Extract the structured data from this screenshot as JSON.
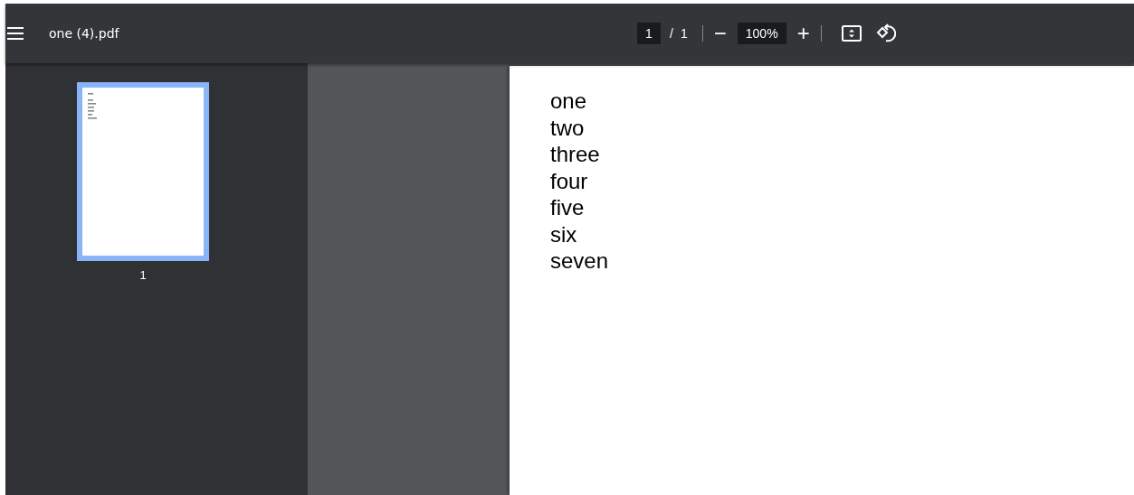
{
  "toolbar": {
    "file_name": "one (4).pdf",
    "page_input": "1",
    "page_separator": "/",
    "page_count": "1",
    "zoom_out": "−",
    "zoom_value": "100%",
    "zoom_in": "+"
  },
  "sidebar": {
    "thumbnails": [
      {
        "label": "1",
        "selected": true
      }
    ]
  },
  "document": {
    "lines": [
      "one",
      "two",
      "three",
      "four",
      "five",
      "six",
      "seven"
    ]
  }
}
